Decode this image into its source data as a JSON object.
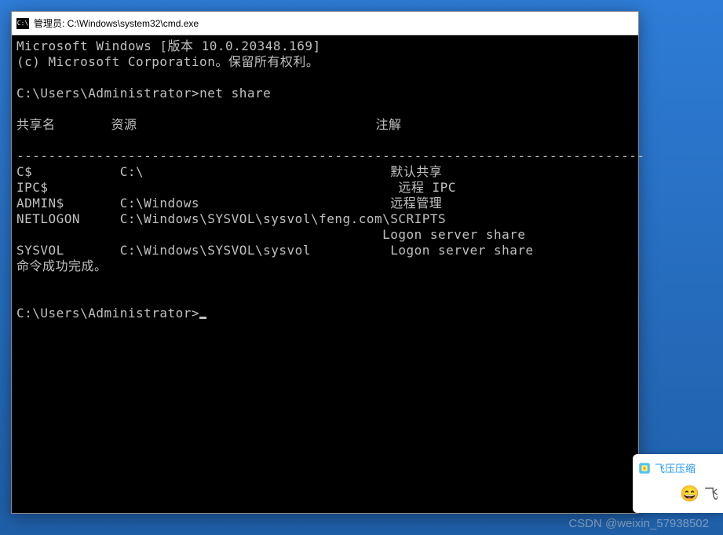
{
  "window": {
    "icon_label": "C:\\",
    "title": "管理员: C:\\Windows\\system32\\cmd.exe"
  },
  "terminal": {
    "header1": "Microsoft Windows [版本 10.0.20348.169]",
    "header2": "(c) Microsoft Corporation。保留所有权利。",
    "prompt1": "C:\\Users\\Administrator>",
    "command1": "net share",
    "col_share": "共享名",
    "col_resource": "资源",
    "col_remark": "注解",
    "separator": "-------------------------------------------------------------------------------",
    "rows": [
      {
        "share": "C$",
        "resource": "C:\\",
        "remark": "默认共享"
      },
      {
        "share": "IPC$",
        "resource": "",
        "remark": "远程 IPC"
      },
      {
        "share": "ADMIN$",
        "resource": "C:\\Windows",
        "remark": "远程管理"
      },
      {
        "share": "NETLOGON",
        "resource": "C:\\Windows\\SYSVOL\\sysvol\\feng.com\\SCRIPTS",
        "remark": ""
      },
      {
        "share": "",
        "resource": "",
        "remark": "Logon server share"
      },
      {
        "share": "SYSVOL",
        "resource": "C:\\Windows\\SYSVOL\\sysvol",
        "remark": "Logon server share"
      }
    ],
    "success": "命令成功完成。",
    "prompt2": "C:\\Users\\Administrator>"
  },
  "popup": {
    "title": "飞压压缩",
    "fly_text": "飞"
  },
  "watermark": "CSDN @weixin_57938502"
}
